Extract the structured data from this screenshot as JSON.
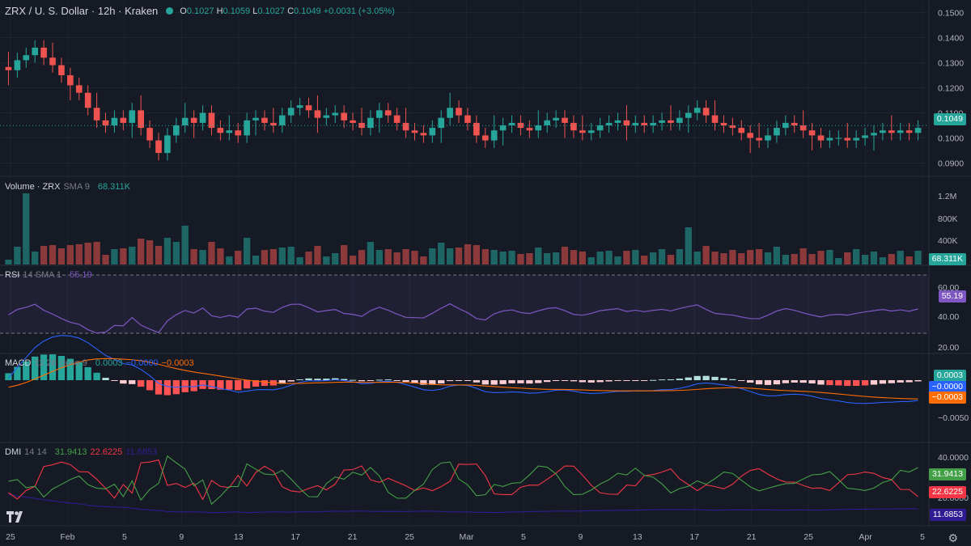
{
  "header": {
    "symbol": "ZRX / U. S. Dollar · 12h · Kraken",
    "ohlc": {
      "o_label": "O",
      "o": "0.1027",
      "h_label": "H",
      "h": "0.1059",
      "l_label": "L",
      "l": "0.1027",
      "c_label": "C",
      "c": "0.1049",
      "change": "+0.0031 (+3.05%)"
    }
  },
  "panes": {
    "volume": {
      "title": "Volume · ZRX",
      "params": "SMA 9",
      "value": "68.311K",
      "badge": "68.311K",
      "ticks": [
        "1.2M",
        "800K",
        "400K"
      ]
    },
    "rsi": {
      "title": "RSI",
      "params": "14 SMA 1",
      "value": "55.19",
      "badge": "55.19",
      "ticks": [
        "60.00",
        "40.00",
        "20.00"
      ]
    },
    "macd": {
      "title": "MACD",
      "params": "12 26 close 9",
      "v1": "0.0003",
      "v2": "−0.0000",
      "v3": "−0.0003",
      "badges": [
        "0.0003",
        "−0.0000",
        "−0.0003"
      ],
      "ticks": [
        "−0.0050"
      ]
    },
    "dmi": {
      "title": "DMI",
      "params": "14 14",
      "v1": "31.9413",
      "v2": "22.6225",
      "v3": "11.6853",
      "badges": [
        "31.9413",
        "22.6225",
        "11.6853"
      ],
      "ticks": [
        "40.0000",
        "20.0000"
      ]
    }
  },
  "price_axis": {
    "ticks": [
      "0.1500",
      "0.1400",
      "0.1300",
      "0.1200",
      "0.1100",
      "0.1000",
      "0.0900"
    ],
    "last_price_badge": "0.1049"
  },
  "time_axis": {
    "labels": [
      "25",
      "Feb",
      "5",
      "9",
      "13",
      "17",
      "21",
      "25",
      "Mar",
      "5",
      "9",
      "13",
      "17",
      "21",
      "25",
      "Apr",
      "5"
    ]
  },
  "colors": {
    "up": "#26a69a",
    "down": "#ef5350",
    "rsi": "#7e57c2",
    "macd": "#2962ff",
    "signal": "#ff6d00",
    "plus_di": "#43a047",
    "minus_di": "#f23645",
    "adx": "#311b92"
  },
  "icons": {
    "logo": "tradingview-logo-icon",
    "settings": "gear-icon",
    "status": "green-dot-icon"
  },
  "chart_data": {
    "type": "candlestick",
    "title": "ZRX / U. S. Dollar · 12h · Kraken",
    "ylim": [
      0.085,
      0.155
    ],
    "last_close": 0.1049,
    "x_tick_labels": [
      "25",
      "Feb",
      "5",
      "9",
      "13",
      "17",
      "21",
      "25",
      "Mar",
      "5",
      "9",
      "13",
      "17",
      "21",
      "25",
      "Apr",
      "5"
    ],
    "close_path": [
      0.127,
      0.131,
      0.133,
      0.136,
      0.132,
      0.129,
      0.125,
      0.121,
      0.118,
      0.112,
      0.107,
      0.105,
      0.108,
      0.106,
      0.111,
      0.104,
      0.099,
      0.094,
      0.101,
      0.105,
      0.108,
      0.106,
      0.11,
      0.104,
      0.102,
      0.103,
      0.101,
      0.107,
      0.108,
      0.106,
      0.105,
      0.109,
      0.112,
      0.113,
      0.111,
      0.108,
      0.109,
      0.11,
      0.107,
      0.106,
      0.104,
      0.108,
      0.111,
      0.109,
      0.106,
      0.103,
      0.102,
      0.101,
      0.104,
      0.108,
      0.112,
      0.109,
      0.106,
      0.101,
      0.099,
      0.103,
      0.105,
      0.106,
      0.104,
      0.103,
      0.105,
      0.107,
      0.108,
      0.106,
      0.103,
      0.102,
      0.103,
      0.105,
      0.106,
      0.107,
      0.105,
      0.106,
      0.105,
      0.106,
      0.107,
      0.106,
      0.108,
      0.11,
      0.112,
      0.109,
      0.106,
      0.105,
      0.104,
      0.102,
      0.1,
      0.099,
      0.101,
      0.104,
      0.106,
      0.105,
      0.103,
      0.101,
      0.099,
      0.1,
      0.1,
      0.099,
      0.1,
      0.101,
      0.102,
      0.103,
      0.102,
      0.103,
      0.102,
      0.104
    ]
  }
}
